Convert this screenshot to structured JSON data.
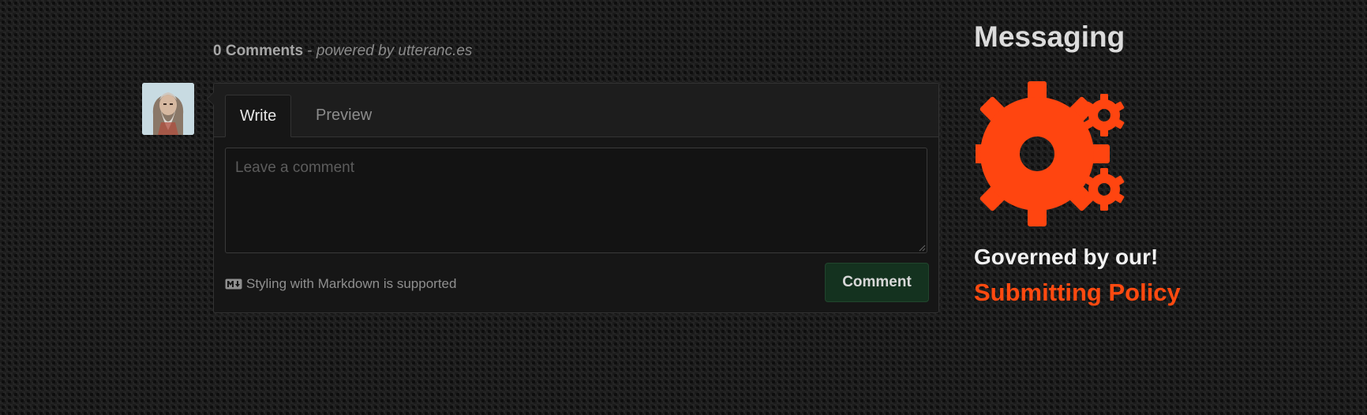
{
  "comments": {
    "count_label": "0 Comments",
    "separator": " - ",
    "powered_by": "powered by utteranc.es"
  },
  "editor": {
    "tabs": [
      {
        "label": "Write",
        "active": true
      },
      {
        "label": "Preview",
        "active": false
      }
    ],
    "textarea_placeholder": "Leave a comment",
    "markdown_note": "Styling with Markdown is supported",
    "submit_label": "Comment"
  },
  "sidebar": {
    "title": "Messaging",
    "icon": "gears-icon",
    "governed_text": "Governed by our!",
    "policy_link": "Submitting Policy"
  },
  "colors": {
    "accent": "#ff4a10",
    "button_bg": "#14321f",
    "panel_bg": "#161616"
  }
}
